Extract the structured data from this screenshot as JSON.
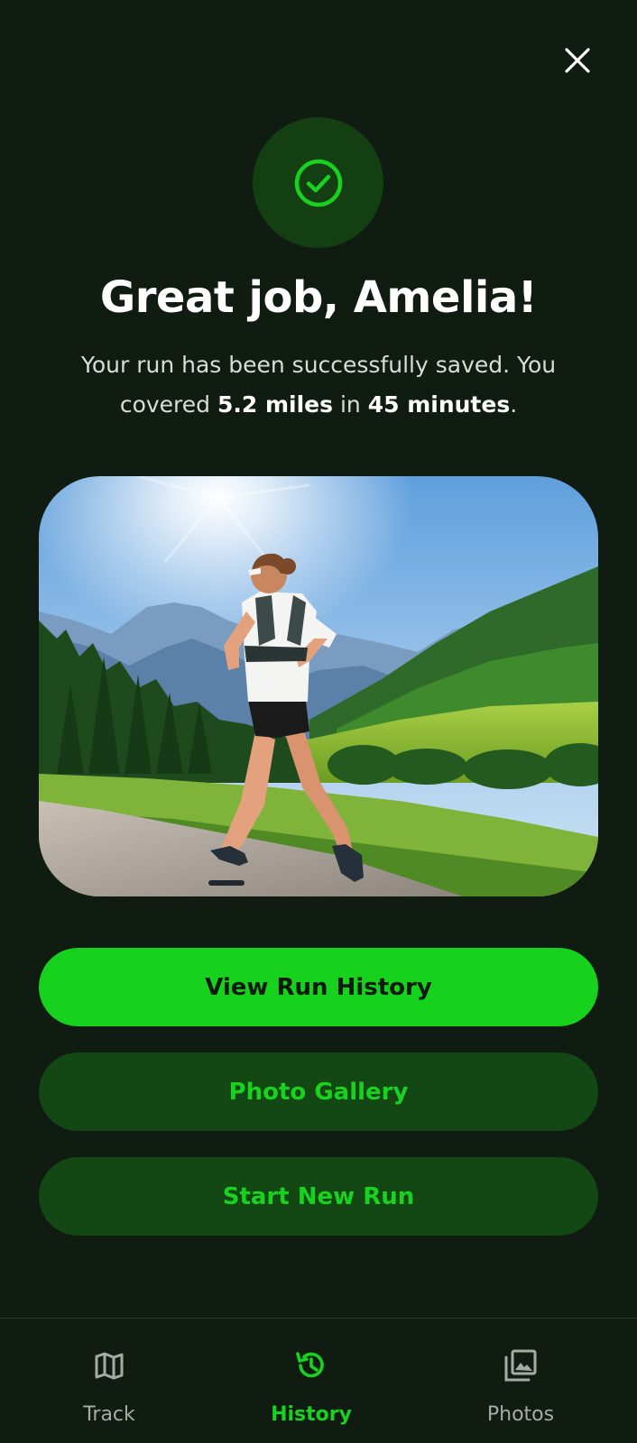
{
  "header": {
    "close_icon": "close-icon"
  },
  "success": {
    "icon": "check-circle-icon",
    "accent_color": "#16d21c",
    "headline": "Great job, Amelia!",
    "message_prefix": "Your run has been successfully saved. You covered ",
    "distance": "5.2 miles",
    "message_middle": " in ",
    "duration": "45 minutes",
    "message_suffix": "."
  },
  "photo": {
    "subject": "runner-on-mountain-trail"
  },
  "actions": {
    "primary_label": "View Run History",
    "gallery_label": "Photo Gallery",
    "new_run_label": "Start New Run"
  },
  "nav": {
    "items": [
      {
        "label": "Track",
        "icon": "map-icon",
        "active": false
      },
      {
        "label": "History",
        "icon": "history-icon",
        "active": true
      },
      {
        "label": "Photos",
        "icon": "photo-library-icon",
        "active": false
      }
    ]
  },
  "colors": {
    "background": "#101c12",
    "primary_button": "#16d21c",
    "secondary_button": "#134713",
    "inactive_nav": "#a7aba7"
  }
}
